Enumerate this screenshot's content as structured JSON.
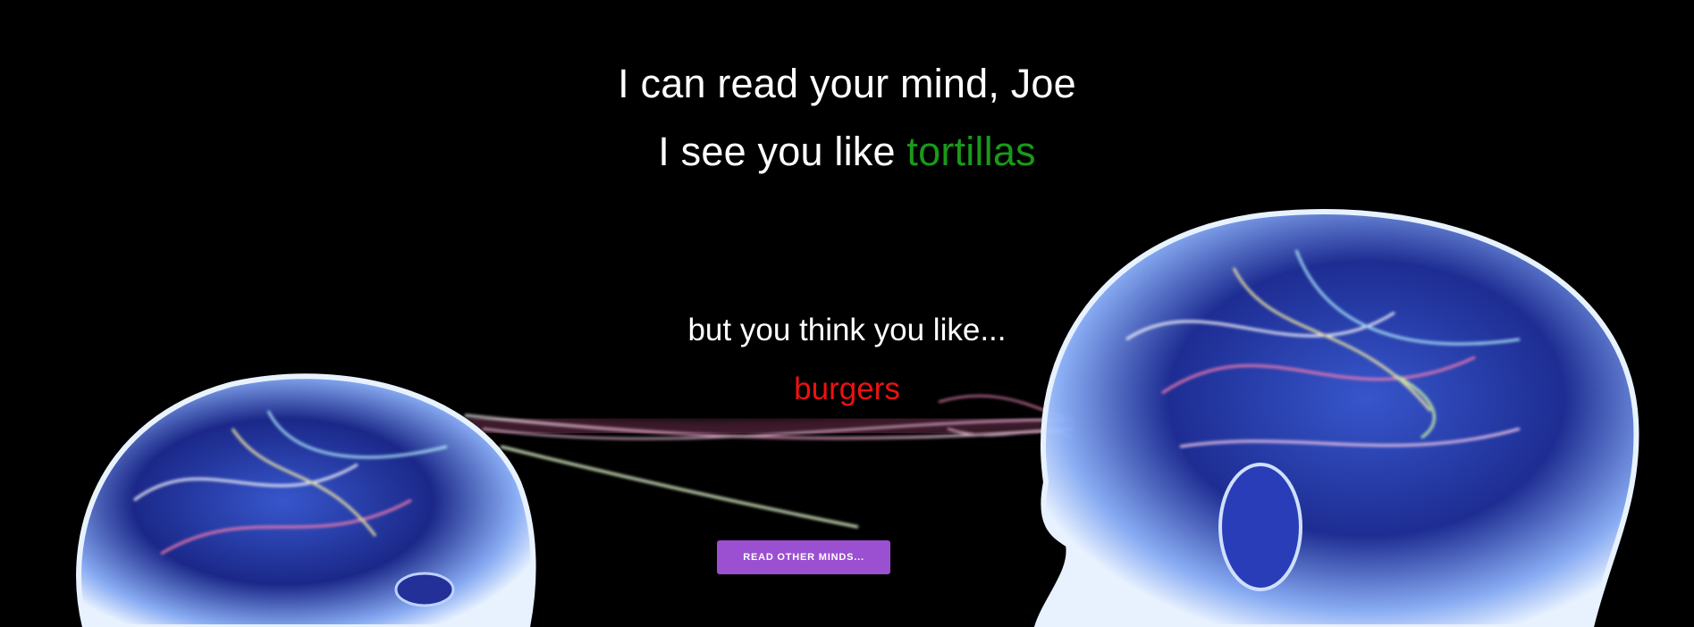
{
  "hero": {
    "line1": "I can read your mind, Joe",
    "line2_prefix": "I see you like ",
    "line2_food": "tortillas",
    "line3": "but you think you like...",
    "line4_food": "burgers",
    "cta_label": "READ OTHER MINDS..."
  },
  "colors": {
    "background": "#000000",
    "true_food": "#1a9a1a",
    "thought_food": "#ee1111",
    "button": "#9b4fd1"
  },
  "background_image": "two glowing translucent blue heads with neural light streaks connecting them"
}
